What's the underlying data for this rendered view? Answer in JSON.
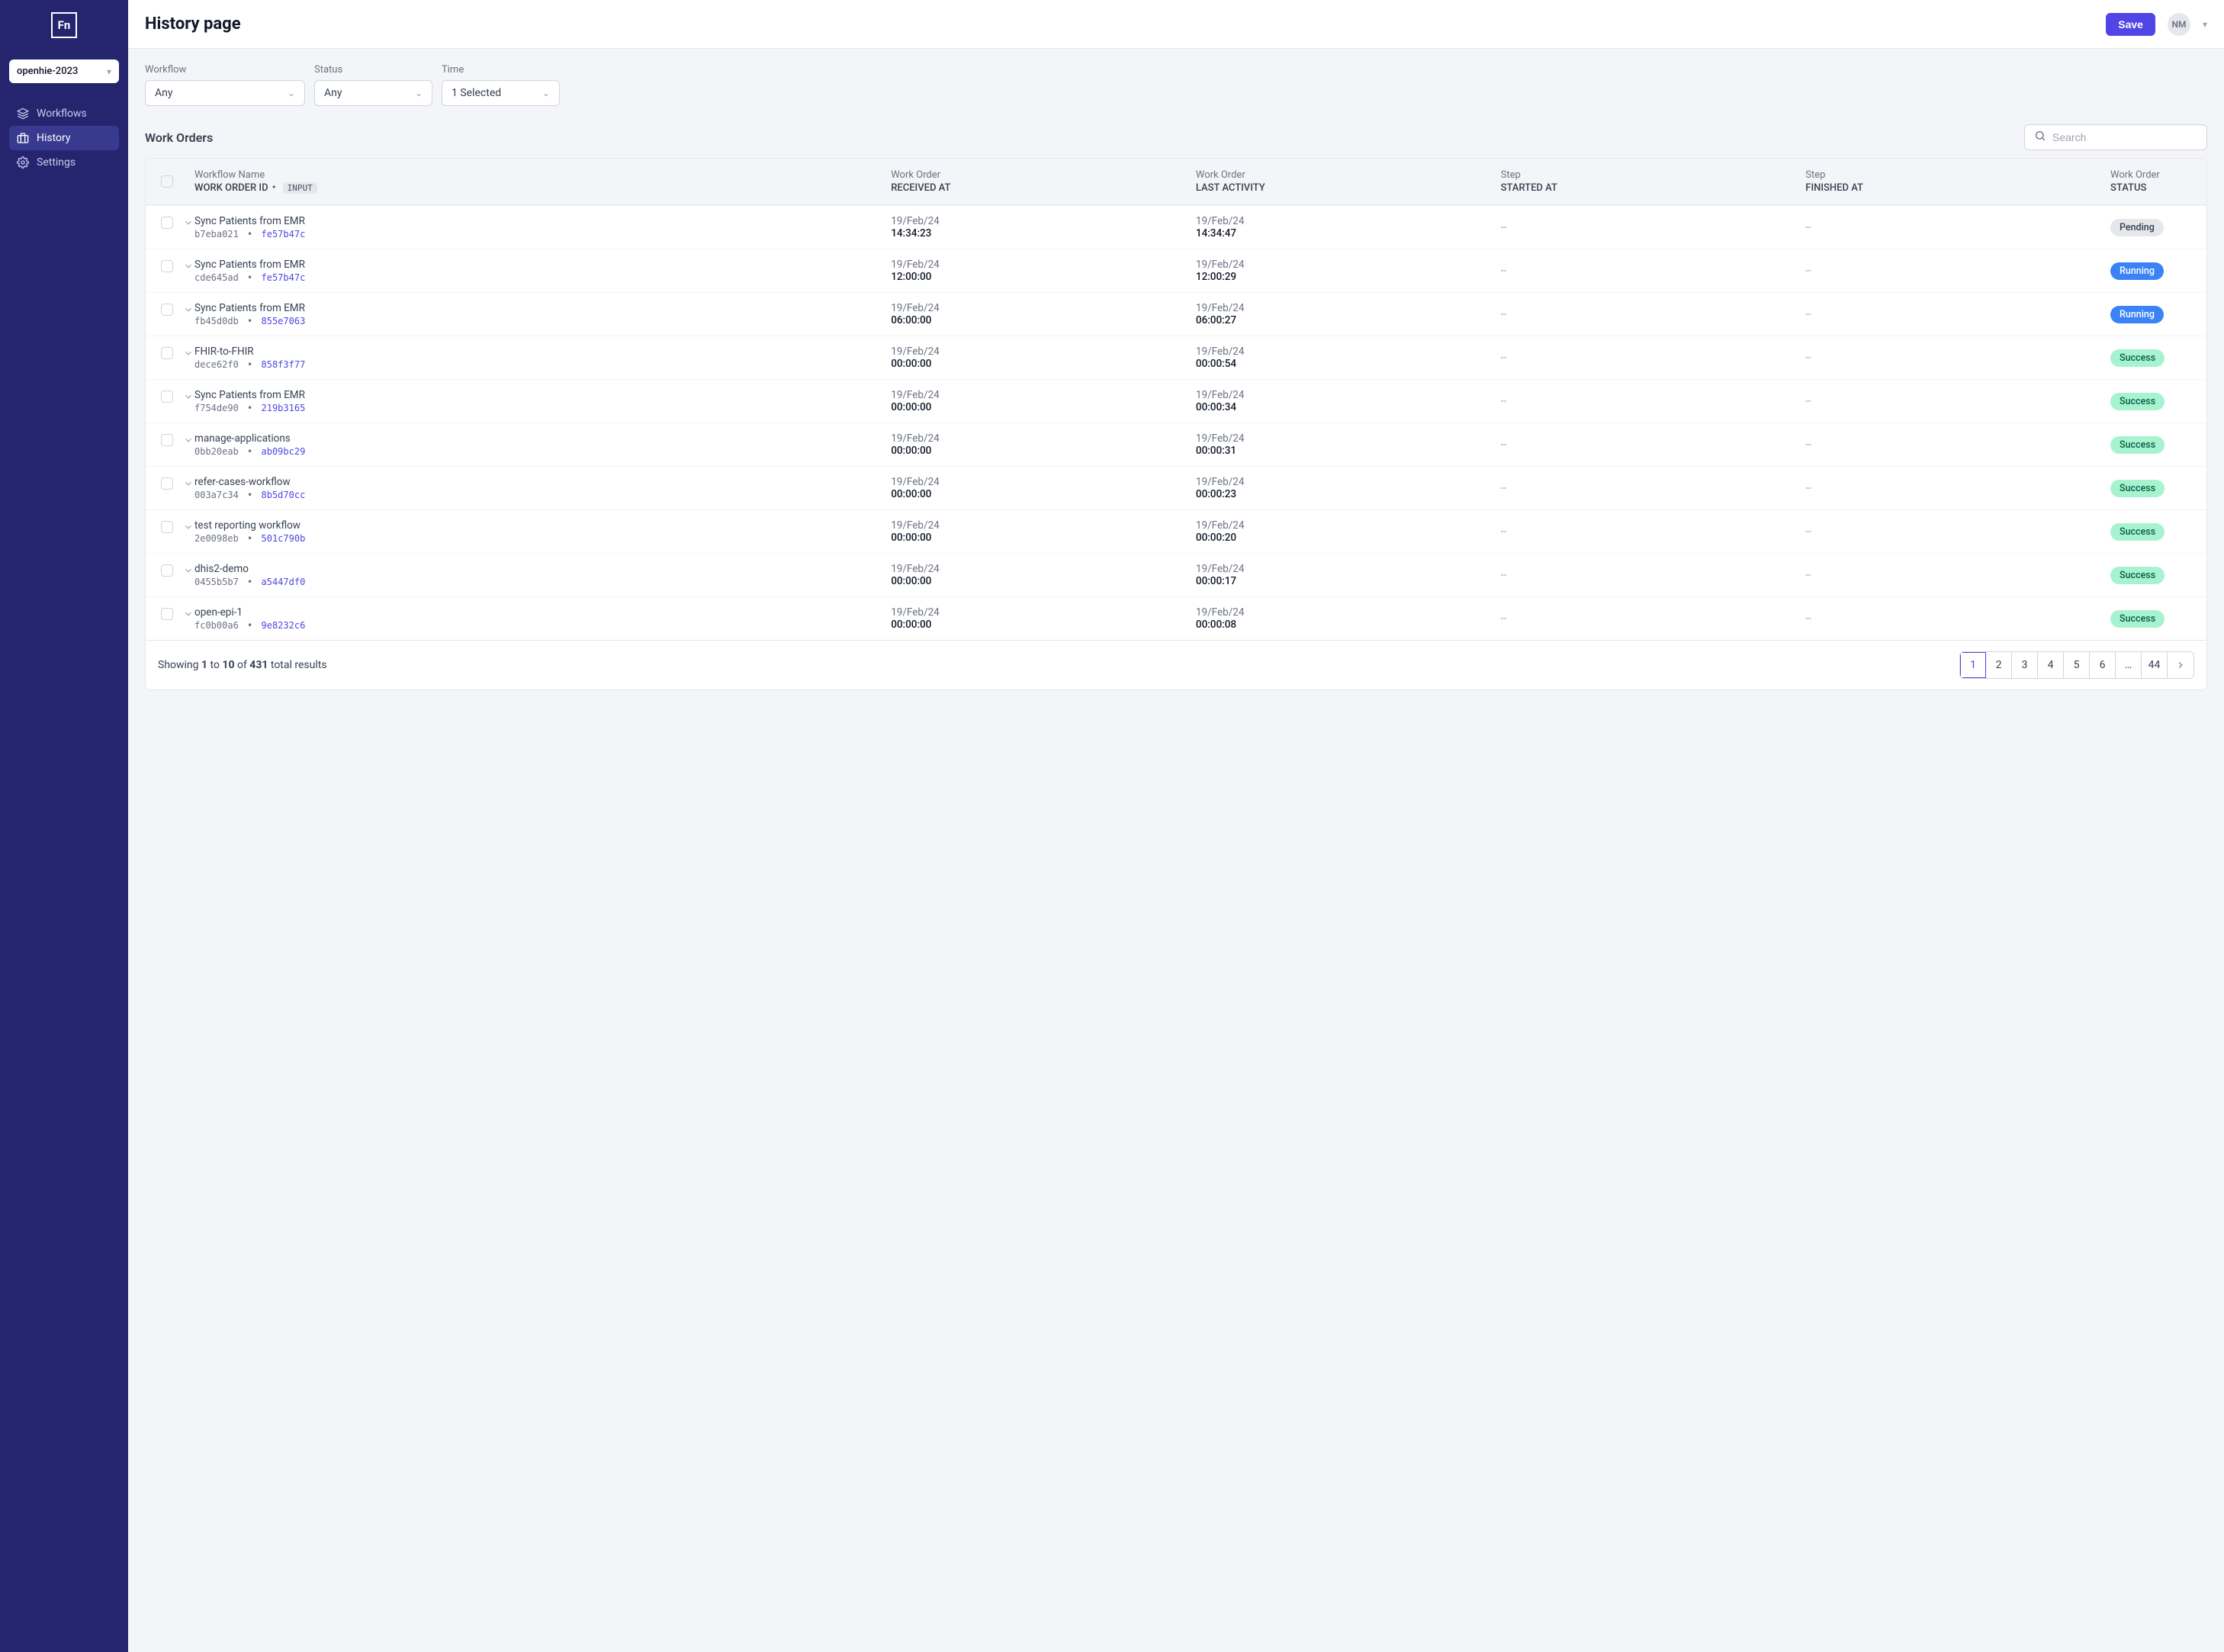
{
  "logo": "Fn",
  "project_selected": "openhie-2023",
  "nav": {
    "workflows": "Workflows",
    "history": "History",
    "settings": "Settings"
  },
  "page_title": "History page",
  "save_label": "Save",
  "user_initials": "NM",
  "filters": {
    "workflow": {
      "label": "Workflow",
      "value": "Any"
    },
    "status": {
      "label": "Status",
      "value": "Any"
    },
    "time": {
      "label": "Time",
      "value": "1 Selected"
    }
  },
  "work_orders_title": "Work Orders",
  "search_placeholder": "Search",
  "table_headers": {
    "name_l1": "Workflow Name",
    "name_l2": "WORK ORDER ID",
    "input_badge": "INPUT",
    "received_l1": "Work Order",
    "received_l2": "RECEIVED AT",
    "activity_l1": "Work Order",
    "activity_l2": "LAST ACTIVITY",
    "started_l1": "Step",
    "started_l2": "STARTED AT",
    "finished_l1": "Step",
    "finished_l2": "FINISHED AT",
    "status_l1": "Work Order",
    "status_l2": "STATUS"
  },
  "rows": [
    {
      "workflow": "Sync Patients from EMR",
      "id": "b7eba021",
      "hash": "fe57b47c",
      "received_d": "19/Feb/24",
      "received_t": "14:34:23",
      "activity_d": "19/Feb/24",
      "activity_t": "14:34:47",
      "started": "--",
      "finished": "--",
      "status": "Pending",
      "badge": "pending"
    },
    {
      "workflow": "Sync Patients from EMR",
      "id": "cde645ad",
      "hash": "fe57b47c",
      "received_d": "19/Feb/24",
      "received_t": "12:00:00",
      "activity_d": "19/Feb/24",
      "activity_t": "12:00:29",
      "started": "--",
      "finished": "--",
      "status": "Running",
      "badge": "running"
    },
    {
      "workflow": "Sync Patients from EMR",
      "id": "fb45d0db",
      "hash": "855e7063",
      "received_d": "19/Feb/24",
      "received_t": "06:00:00",
      "activity_d": "19/Feb/24",
      "activity_t": "06:00:27",
      "started": "--",
      "finished": "--",
      "status": "Running",
      "badge": "running"
    },
    {
      "workflow": "FHIR-to-FHIR",
      "id": "dece62f0",
      "hash": "858f3f77",
      "received_d": "19/Feb/24",
      "received_t": "00:00:00",
      "activity_d": "19/Feb/24",
      "activity_t": "00:00:54",
      "started": "--",
      "finished": "--",
      "status": "Success",
      "badge": "success"
    },
    {
      "workflow": "Sync Patients from EMR",
      "id": "f754de90",
      "hash": "219b3165",
      "received_d": "19/Feb/24",
      "received_t": "00:00:00",
      "activity_d": "19/Feb/24",
      "activity_t": "00:00:34",
      "started": "--",
      "finished": "--",
      "status": "Success",
      "badge": "success"
    },
    {
      "workflow": "manage-applications",
      "id": "0bb20eab",
      "hash": "ab09bc29",
      "received_d": "19/Feb/24",
      "received_t": "00:00:00",
      "activity_d": "19/Feb/24",
      "activity_t": "00:00:31",
      "started": "--",
      "finished": "--",
      "status": "Success",
      "badge": "success"
    },
    {
      "workflow": "refer-cases-workflow",
      "id": "003a7c34",
      "hash": "8b5d70cc",
      "received_d": "19/Feb/24",
      "received_t": "00:00:00",
      "activity_d": "19/Feb/24",
      "activity_t": "00:00:23",
      "started": "--",
      "finished": "--",
      "status": "Success",
      "badge": "success"
    },
    {
      "workflow": "test reporting workflow",
      "id": "2e0098eb",
      "hash": "501c790b",
      "received_d": "19/Feb/24",
      "received_t": "00:00:00",
      "activity_d": "19/Feb/24",
      "activity_t": "00:00:20",
      "started": "--",
      "finished": "--",
      "status": "Success",
      "badge": "success"
    },
    {
      "workflow": "dhis2-demo",
      "id": "0455b5b7",
      "hash": "a5447df0",
      "received_d": "19/Feb/24",
      "received_t": "00:00:00",
      "activity_d": "19/Feb/24",
      "activity_t": "00:00:17",
      "started": "--",
      "finished": "--",
      "status": "Success",
      "badge": "success"
    },
    {
      "workflow": "open-epi-1",
      "id": "fc0b00a6",
      "hash": "9e8232c6",
      "received_d": "19/Feb/24",
      "received_t": "00:00:00",
      "activity_d": "19/Feb/24",
      "activity_t": "00:00:08",
      "started": "--",
      "finished": "--",
      "status": "Success",
      "badge": "success"
    }
  ],
  "footer": {
    "showing_prefix": "Showing ",
    "start": "1",
    "to_word": " to ",
    "end": "10",
    "of_word": " of ",
    "total": "431",
    "suffix": " total results",
    "pages": [
      "1",
      "2",
      "3",
      "4",
      "5",
      "6",
      "…",
      "44"
    ],
    "active_page": "1"
  }
}
